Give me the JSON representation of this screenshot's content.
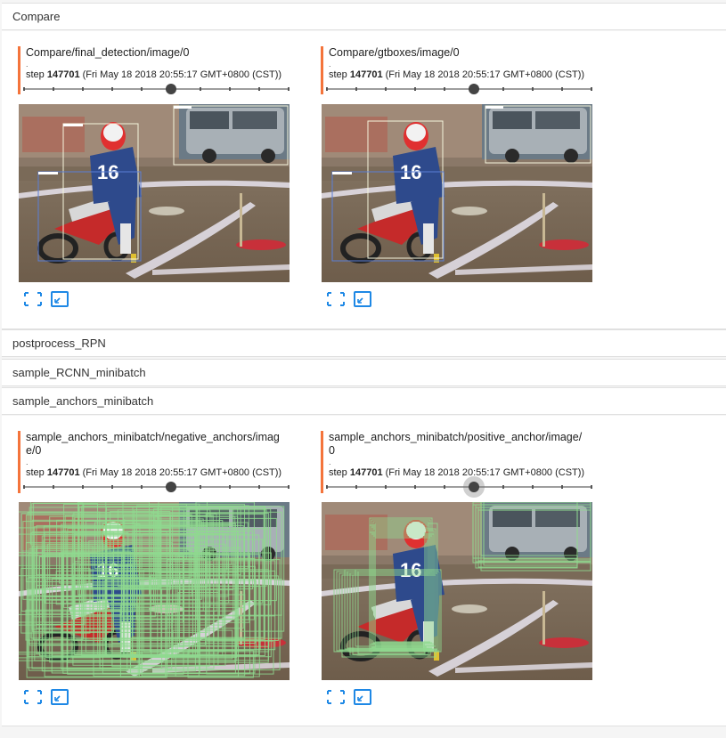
{
  "groups": [
    {
      "name": "Compare"
    },
    {
      "name": "postprocess_RPN"
    },
    {
      "name": "sample_RCNN_minibatch"
    },
    {
      "name": "sample_anchors_minibatch"
    }
  ],
  "cards": {
    "c1": {
      "title": "Compare/final_detection/image/0",
      "dot": ".",
      "step_label": "step",
      "step_value": "147701",
      "timestamp": "(Fri May 18 2018 20:55:17 GMT+0800 (CST))",
      "slider_pos": 0.555
    },
    "c2": {
      "title": "Compare/gtboxes/image/0",
      "dot": ".",
      "step_label": "step",
      "step_value": "147701",
      "timestamp": "(Fri May 18 2018 20:55:17 GMT+0800 (CST))",
      "slider_pos": 0.555
    },
    "c3": {
      "title": "sample_anchors_minibatch/negative_anchors/image/0",
      "dot": ".",
      "step_label": "step",
      "step_value": "147701",
      "timestamp": "(Fri May 18 2018 20:55:17 GMT+0800 (CST))",
      "slider_pos": 0.555
    },
    "c4": {
      "title": "sample_anchors_minibatch/positive_anchor/image/0",
      "dot": ".",
      "step_label": "step",
      "step_value": "147701",
      "timestamp": "(Fri May 18 2018 20:55:17 GMT+0800 (CST))",
      "slider_pos": 0.555
    }
  },
  "icons": {
    "expand": "fullscreen-icon",
    "fit": "fit-to-size-icon"
  },
  "colors": {
    "accent": "#f4743b",
    "icon_blue": "#1e88e5",
    "anchor_green": "#8fd98f",
    "box_white": "#f5f5dc",
    "box_blue": "#5b7fd6"
  }
}
